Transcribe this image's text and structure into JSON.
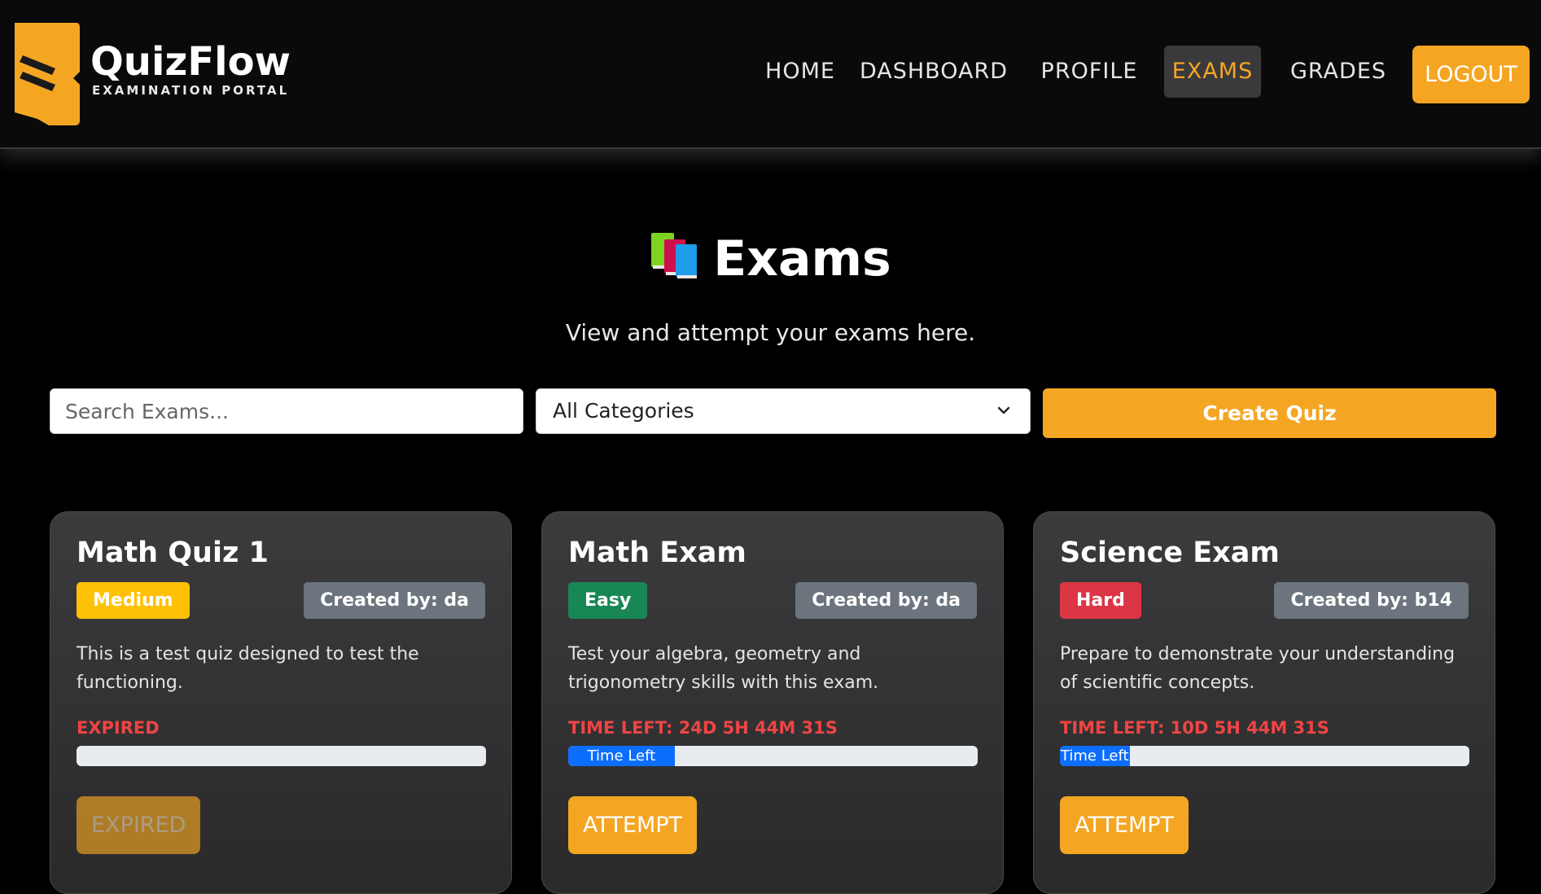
{
  "brand": {
    "title": "QuizFlow",
    "subtitle": "EXAMINATION PORTAL"
  },
  "nav": {
    "items": [
      {
        "label": "HOME",
        "active": false
      },
      {
        "label": "DASHBOARD",
        "active": false
      },
      {
        "label": "PROFILE",
        "active": false
      },
      {
        "label": "EXAMS",
        "active": true
      },
      {
        "label": "GRADES",
        "active": false
      }
    ],
    "logout_label": "LOGOUT"
  },
  "hero": {
    "icon": "books-icon",
    "title": "Exams",
    "subtitle": "View and attempt your exams here."
  },
  "controls": {
    "search_placeholder": "Search Exams...",
    "category_selected": "All Categories",
    "create_label": "Create Quiz"
  },
  "colors": {
    "accent": "#f4a623",
    "medium": "#ffc107",
    "easy": "#198754",
    "hard": "#dc3545",
    "progress": "#0d6efd",
    "danger_text": "#ef4444"
  },
  "cards": [
    {
      "title": "Math Quiz 1",
      "difficulty": "Medium",
      "creator": "Created by: da",
      "description": "This is a test quiz designed to test the functioning.",
      "status": "EXPIRED",
      "progress_label": "",
      "progress_fraction": 0,
      "button_label": "EXPIRED",
      "button_enabled": false
    },
    {
      "title": "Math Exam",
      "difficulty": "Easy",
      "creator": "Created by: da",
      "description": "Test your algebra, geometry and trigonometry skills with this exam.",
      "status": "TIME LEFT: 24D 5H 44M 31S",
      "progress_label": "Time Left",
      "progress_fraction": 0.26,
      "button_label": "ATTEMPT",
      "button_enabled": true
    },
    {
      "title": "Science Exam",
      "difficulty": "Hard",
      "creator": "Created by: b14",
      "description": "Prepare to demonstrate your understanding of scientific concepts.",
      "status": "TIME LEFT: 10D 5H 44M 31S",
      "progress_label": "Time Left",
      "progress_fraction": 0.17,
      "button_label": "ATTEMPT",
      "button_enabled": true
    }
  ]
}
